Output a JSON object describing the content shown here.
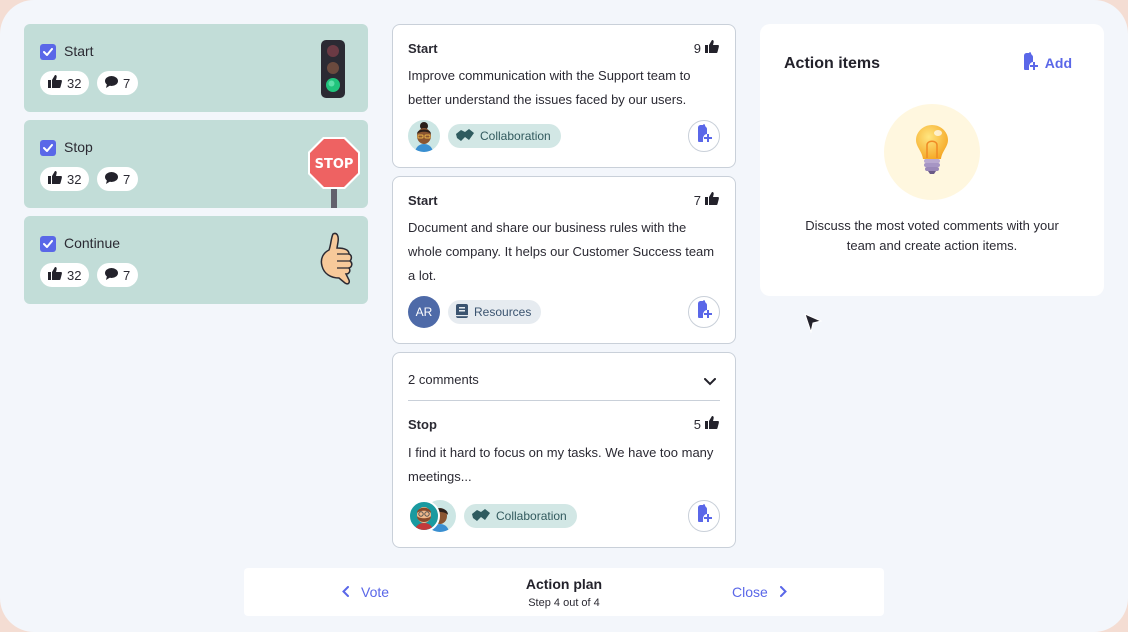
{
  "categories": [
    {
      "name": "Start",
      "checked": true,
      "likes": "32",
      "comments": "7",
      "illustration": "traffic-light"
    },
    {
      "name": "Stop",
      "checked": true,
      "likes": "32",
      "comments": "7",
      "illustration": "stop-sign",
      "sign_text": "STOP"
    },
    {
      "name": "Continue",
      "checked": true,
      "likes": "32",
      "comments": "7",
      "illustration": "thumbs-up-hand"
    }
  ],
  "cards": [
    {
      "label": "Start",
      "votes": "9",
      "text": "Improve communication with the Support team to better understand the issues faced by our users.",
      "avatar": "woman-avatar",
      "tag": "Collaboration",
      "tag_icon": "handshake-icon"
    },
    {
      "label": "Start",
      "votes": "7",
      "text": "Document and share our business rules with the whole company. It helps our Customer Success team a lot.",
      "avatar_initials": "AR",
      "tag": "Resources",
      "tag_icon": "book-icon"
    }
  ],
  "group": {
    "title": "2 comments",
    "expanded": false,
    "card": {
      "label": "Stop",
      "votes": "5",
      "text": "I find it hard to focus on my tasks. We have too many meetings...",
      "avatars": [
        "bearded-man-avatar",
        "woman-avatar"
      ],
      "tag": "Collaboration",
      "tag_icon": "handshake-icon"
    }
  },
  "action_items": {
    "title": "Action items",
    "add_label": "Add",
    "description": "Discuss the most voted comments with your team and create action items."
  },
  "footer": {
    "prev_label": "Vote",
    "title": "Action plan",
    "step": "Step 4 out of 4",
    "next_label": "Close"
  },
  "colors": {
    "accent": "#5a67e8",
    "category_bg": "#c2ddd8",
    "page_bg": "#f3f6fb",
    "avatar_ar": "#4e6aa8"
  }
}
